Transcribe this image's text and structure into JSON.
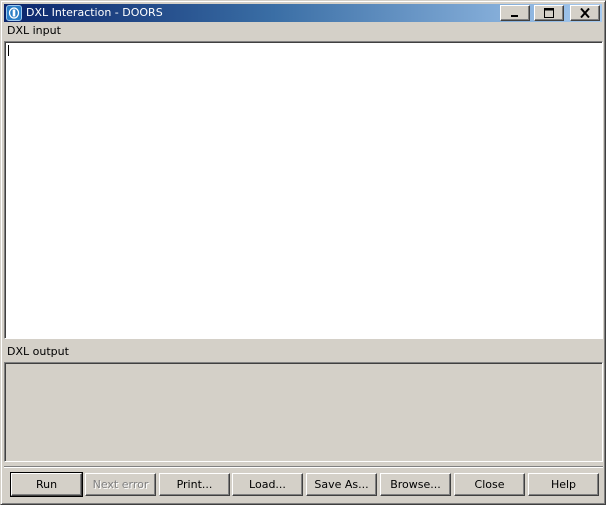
{
  "window": {
    "title": "DXL Interaction - DOORS",
    "app_icon": "doors-app-icon",
    "controls": [
      "minimize-icon",
      "maximize-icon",
      "close-icon"
    ]
  },
  "input_panel": {
    "label": "DXL input",
    "value": ""
  },
  "output_panel": {
    "label": "DXL output",
    "value": ""
  },
  "buttons": {
    "run": "Run",
    "next_error": "Next error",
    "print": "Print...",
    "load": "Load...",
    "save_as": "Save As...",
    "browse": "Browse...",
    "close": "Close",
    "help": "Help"
  },
  "colors": {
    "face": "#d4d0c8",
    "title_start": "#0a246a",
    "title_end": "#a6caf0",
    "disabled_text": "#808080"
  }
}
